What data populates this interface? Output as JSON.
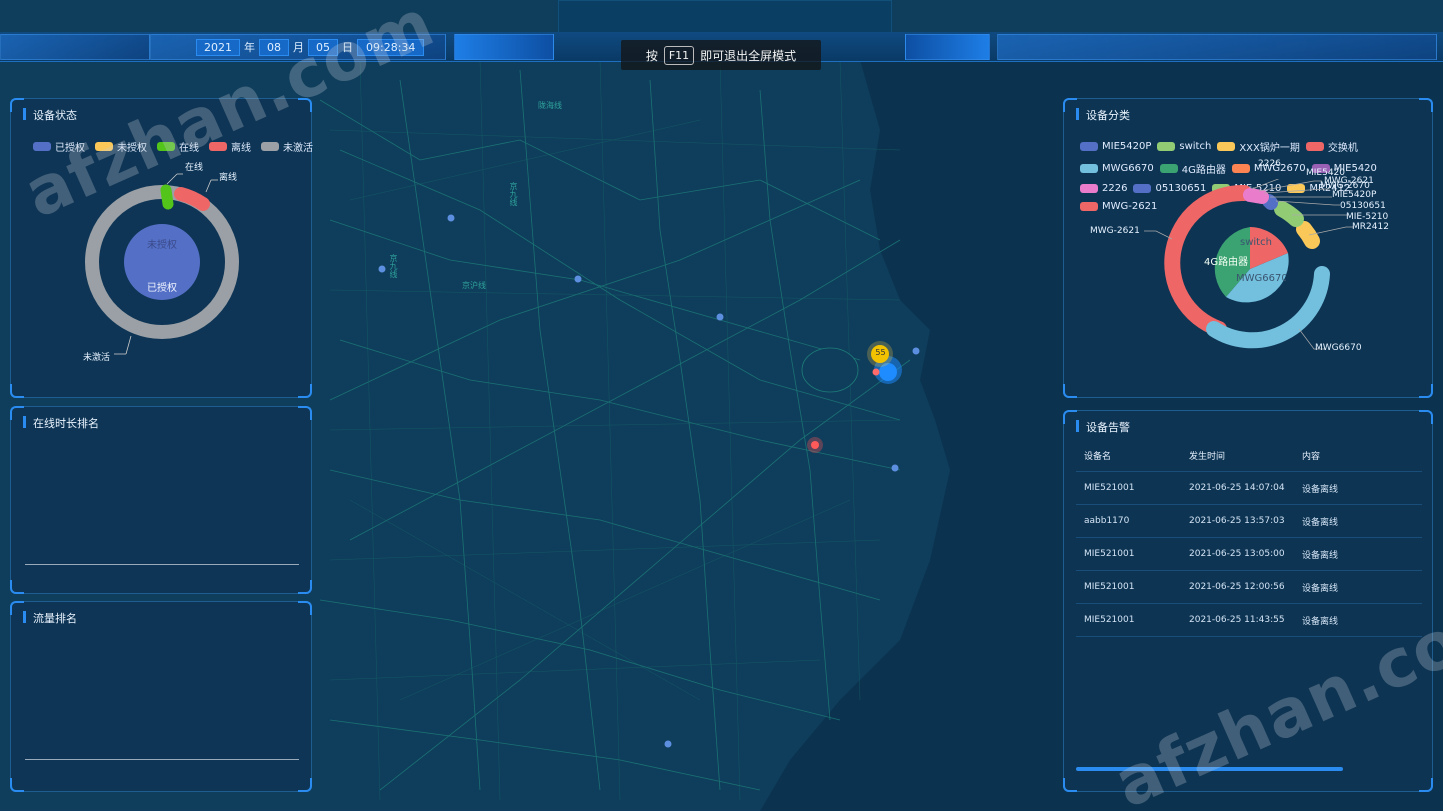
{
  "header": {
    "year": "2021",
    "year_unit": "年",
    "month": "08",
    "month_unit": "月",
    "day": "05",
    "day_unit": "日",
    "time": "09:28:34",
    "fullscreen_prefix": "按",
    "fullscreen_key": "F11",
    "fullscreen_suffix": "即可退出全屏模式"
  },
  "map": {
    "labels": [
      "陇海线",
      "京九线",
      "京九线",
      "京沪线"
    ],
    "cluster_count": "55"
  },
  "device_status": {
    "title": "设备状态",
    "legend": [
      {
        "label": "已授权",
        "color": "#5470c6"
      },
      {
        "label": "未授权",
        "color": "#fac858"
      },
      {
        "label": "在线",
        "color": "#52c41a"
      },
      {
        "label": "离线",
        "color": "#ee6666"
      },
      {
        "label": "未激活",
        "color": "#9aa0a6"
      }
    ],
    "outer_labels": {
      "online": "在线",
      "offline": "离线",
      "inactive": "未激活"
    },
    "inner_labels": {
      "unauthorized": "未授权",
      "authorized": "已授权"
    }
  },
  "online_rank": {
    "title": "在线时长排名"
  },
  "traffic_rank": {
    "title": "流量排名"
  },
  "device_category": {
    "title": "设备分类",
    "legend": [
      {
        "label": "MIE5420P",
        "color": "#5470c6"
      },
      {
        "label": "switch",
        "color": "#91cc75"
      },
      {
        "label": "XXX锅炉一期",
        "color": "#fac858"
      },
      {
        "label": "交换机",
        "color": "#ee6666"
      },
      {
        "label": "MWG6670",
        "color": "#73c0de"
      },
      {
        "label": "4G路由器",
        "color": "#3ba272"
      },
      {
        "label": "MWG2670",
        "color": "#fc8452"
      },
      {
        "label": "MIE5420",
        "color": "#9a60b4"
      },
      {
        "label": "2226",
        "color": "#ea7ccc"
      },
      {
        "label": "05130651",
        "color": "#5470c6"
      },
      {
        "label": "MIE-5210",
        "color": "#91cc75"
      },
      {
        "label": "MR2412",
        "color": "#fac858"
      },
      {
        "label": "MWG-2621",
        "color": "#ee6666"
      }
    ],
    "callouts": [
      "MIE5420",
      "2226",
      "MWG-2621",
      "MWG-2670",
      "MIE5420P",
      "05130651",
      "MIE-5210",
      "MR2412",
      "MWG-2621",
      "MWG6670"
    ],
    "inner_labels": {
      "switch": "switch",
      "router": "4G路由器",
      "mwg": "MWG6670"
    }
  },
  "device_alarm": {
    "title": "设备告警",
    "columns": [
      "设备名",
      "发生时间",
      "内容"
    ],
    "rows": [
      [
        "MIE521001",
        "2021-06-25 14:07:04",
        "设备离线"
      ],
      [
        "aabb1170",
        "2021-06-25 13:57:03",
        "设备离线"
      ],
      [
        "MIE521001",
        "2021-06-25 13:05:00",
        "设备离线"
      ],
      [
        "MIE521001",
        "2021-06-25 12:00:56",
        "设备离线"
      ],
      [
        "MIE521001",
        "2021-06-25 11:43:55",
        "设备离线"
      ]
    ]
  },
  "watermark": "afzhan.com"
}
